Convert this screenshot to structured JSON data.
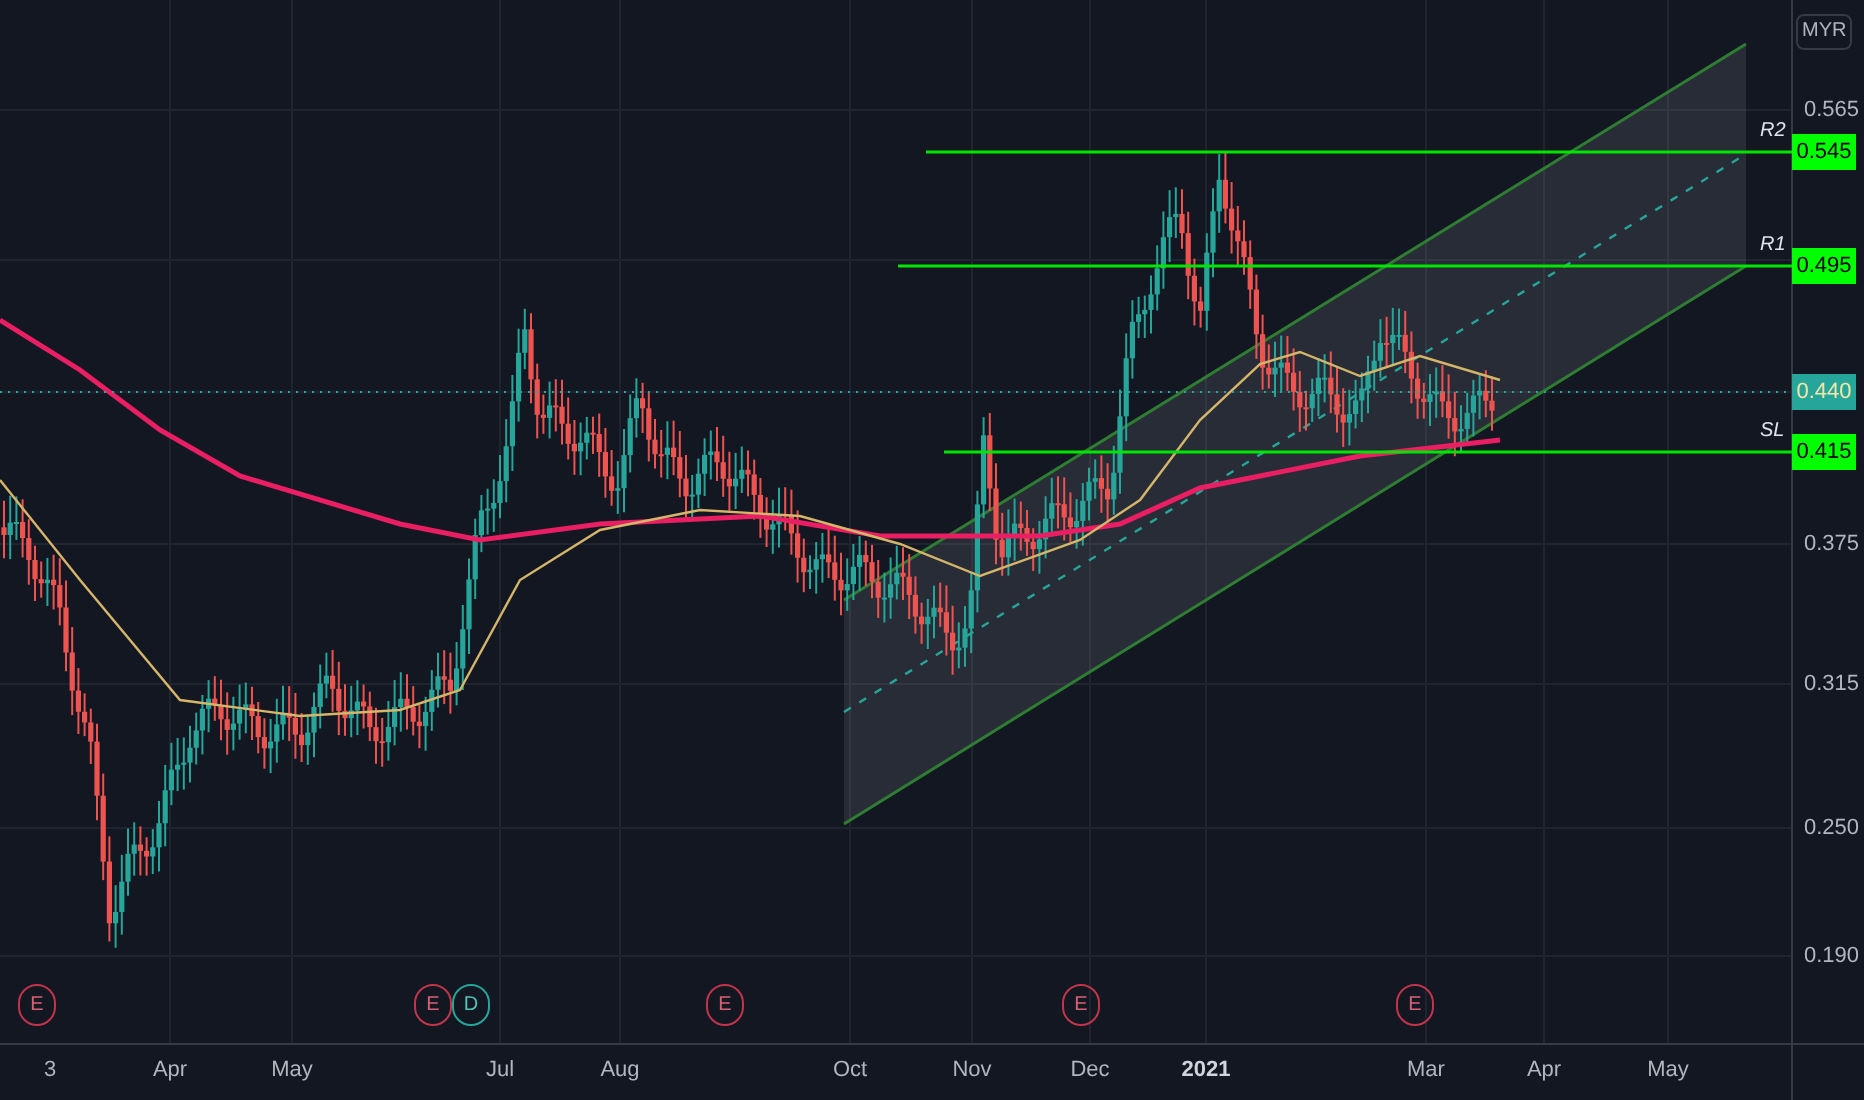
{
  "currency": "MYR",
  "price_axis": [
    "0.565",
    "0.375",
    "0.315",
    "0.250",
    "0.190"
  ],
  "levels": [
    {
      "name": "R2",
      "price": "0.545",
      "kind": "line"
    },
    {
      "name": "R1",
      "price": "0.495",
      "kind": "line"
    },
    {
      "name": "SL",
      "price": "0.415",
      "kind": "line"
    }
  ],
  "last_price": "0.440",
  "time_axis": [
    {
      "label": "3",
      "bold": false
    },
    {
      "label": "Apr",
      "bold": false
    },
    {
      "label": "May",
      "bold": false
    },
    {
      "label": "Jul",
      "bold": false
    },
    {
      "label": "Aug",
      "bold": false
    },
    {
      "label": "Oct",
      "bold": false
    },
    {
      "label": "Nov",
      "bold": false
    },
    {
      "label": "Dec",
      "bold": false
    },
    {
      "label": "2021",
      "bold": true
    },
    {
      "label": "Mar",
      "bold": false
    },
    {
      "label": "Apr",
      "bold": false
    },
    {
      "label": "May",
      "bold": false
    }
  ],
  "events": [
    {
      "label": "E",
      "kind": "earnings"
    },
    {
      "label": "E",
      "kind": "earnings"
    },
    {
      "label": "D",
      "kind": "dividend"
    },
    {
      "label": "E",
      "kind": "earnings"
    },
    {
      "label": "E",
      "kind": "earnings"
    },
    {
      "label": "E",
      "kind": "earnings"
    }
  ]
}
